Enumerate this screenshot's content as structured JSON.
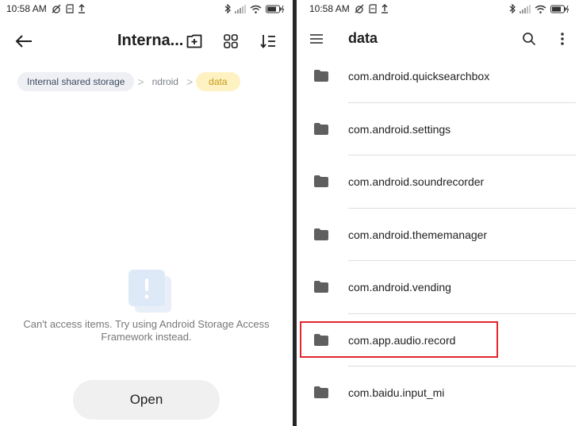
{
  "left": {
    "status": {
      "time": "10:58 AM"
    },
    "toolbar": {
      "title": "Interna..."
    },
    "breadcrumbs": [
      "Internal shared storage",
      "ndroid",
      "data"
    ],
    "empty": {
      "message": "Can't access items. Try using Android Storage Access Framework instead."
    },
    "open_label": "Open"
  },
  "right": {
    "status": {
      "time": "10:58 AM"
    },
    "toolbar": {
      "title": "data"
    },
    "files": [
      "com.android.quicksearchbox",
      "com.android.settings",
      "com.android.soundrecorder",
      "com.android.thememanager",
      "com.android.vending",
      "com.app.audio.record",
      "com.baidu.input_mi"
    ],
    "highlighted_item": "com.app.audio.record"
  },
  "colors": {
    "accent_yellow": "#fff2c2",
    "accent_yellow_text": "#c59a17",
    "highlight_red": "#e3262b",
    "folder_grey": "#5f5f5f"
  }
}
